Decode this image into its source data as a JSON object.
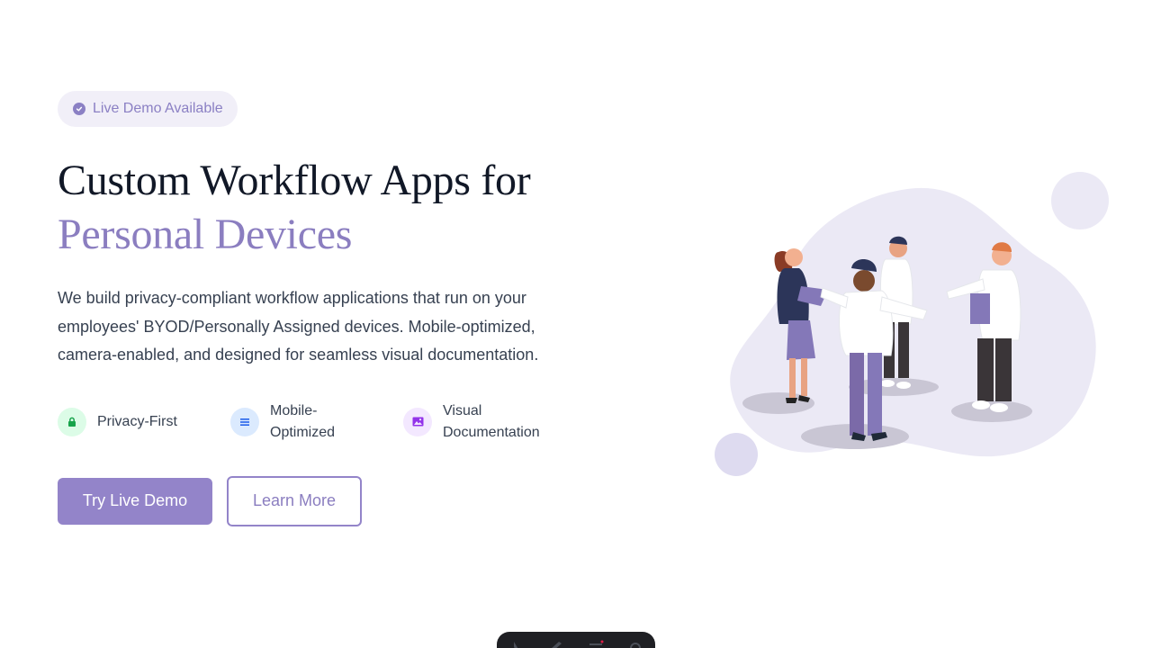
{
  "badge": {
    "icon": "check-circle-icon",
    "label": "Live Demo Available"
  },
  "hero": {
    "title_line1": "Custom Workflow Apps for",
    "title_line2": "Personal Devices",
    "description": "We build privacy-compliant workflow applications that run on your employees' BYOD/Personally Assigned devices. Mobile-optimized, camera-enabled, and designed for seamless visual documentation."
  },
  "features": [
    {
      "icon": "lock-icon",
      "label": "Privacy-First",
      "color": "#16a34a",
      "bg": "#dcfce7"
    },
    {
      "icon": "menu-icon",
      "label": "Mobile-Optimized",
      "color": "#2563eb",
      "bg": "#dbeafe"
    },
    {
      "icon": "image-icon",
      "label": "Visual Documentation",
      "color": "#9333ea",
      "bg": "#f3e8ff"
    }
  ],
  "buttons": {
    "primary": "Try Live Demo",
    "secondary": "Learn More"
  },
  "colors": {
    "accent": "#9384c9",
    "blob": "#ebe9f5"
  },
  "toolbar": {
    "icons": [
      "pointer-icon",
      "pen-icon",
      "list-icon",
      "settings-icon"
    ]
  }
}
